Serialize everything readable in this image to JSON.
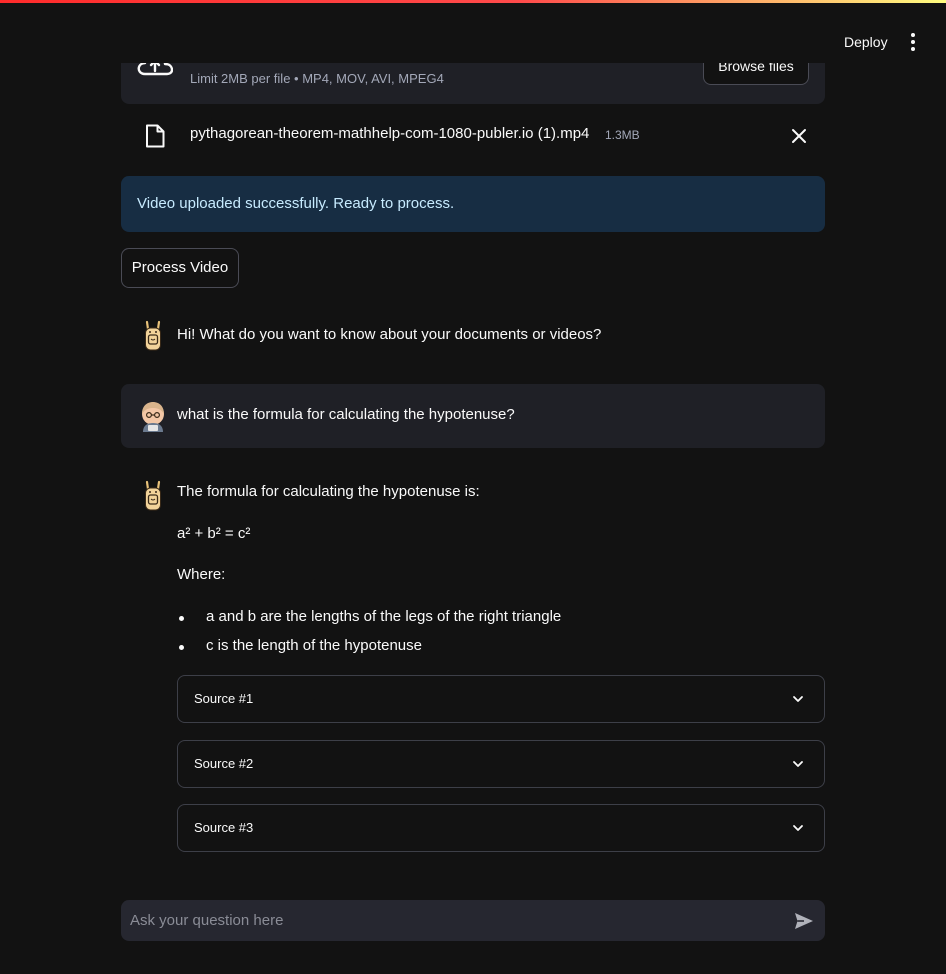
{
  "header": {
    "deploy_label": "Deploy",
    "menu_icon": "kebab-menu-icon"
  },
  "uploader": {
    "icon": "cloud-upload-icon",
    "limit_text": "Limit 2MB per file • MP4, MOV, AVI, MPEG4",
    "browse_label": "Browse files"
  },
  "uploaded_file": {
    "icon": "file-icon",
    "name": "pythagorean-theorem-mathhelp-com-1080-publer.io (1).mp4",
    "size": "1.3MB",
    "remove_icon": "close-icon"
  },
  "alert": {
    "text": "Video uploaded successfully. Ready to process."
  },
  "process_button": {
    "label": "Process Video"
  },
  "chat": {
    "messages": [
      {
        "role": "assistant",
        "avatar": "llama-avatar-icon",
        "text": "Hi! What do you want to know about your documents or videos?"
      },
      {
        "role": "user",
        "avatar": "user-avatar-icon",
        "text": "what is the formula for calculating the hypotenuse?"
      },
      {
        "role": "assistant",
        "avatar": "llama-avatar-icon",
        "intro": "The formula for calculating the hypotenuse is:",
        "formula": "a² + b² = c²",
        "where": "Where:",
        "bullets": [
          "a and b are the lengths of the legs of the right triangle",
          "c is the length of the hypotenuse"
        ],
        "sources": [
          {
            "label": "Source #1"
          },
          {
            "label": "Source #2"
          },
          {
            "label": "Source #3"
          }
        ]
      }
    ]
  },
  "chat_input": {
    "placeholder": "Ask your question here",
    "value": "",
    "send_icon": "send-icon"
  },
  "colors": {
    "background": "#121212",
    "alert_bg": "#172d43",
    "alert_text": "#c7ebff",
    "accent": "#ff4b4b"
  }
}
